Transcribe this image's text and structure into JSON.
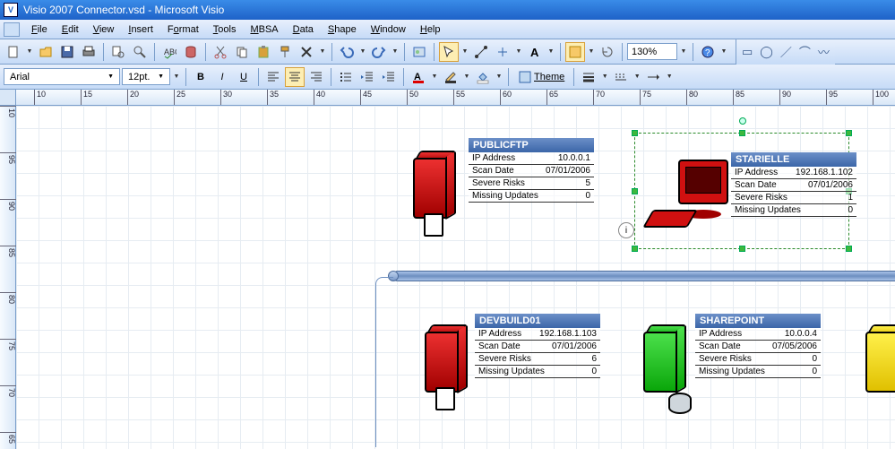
{
  "window": {
    "title": "Visio 2007 Connector.vsd - Microsoft Visio"
  },
  "menu": [
    "File",
    "Edit",
    "View",
    "Insert",
    "Format",
    "Tools",
    "MBSA",
    "Data",
    "Shape",
    "Window",
    "Help"
  ],
  "format": {
    "font": "Arial",
    "size": "12pt.",
    "zoom": "130%",
    "theme": "Theme"
  },
  "ruler_h": [
    "10",
    "15",
    "20",
    "25",
    "30",
    "35",
    "40",
    "45",
    "50",
    "55",
    "60",
    "65",
    "70",
    "75",
    "80",
    "85",
    "90",
    "95",
    "100"
  ],
  "ruler_v": [
    "10",
    "95",
    "90",
    "85",
    "80",
    "75",
    "70",
    "65"
  ],
  "nodes": [
    {
      "name": "PUBLICFTP",
      "rows": [
        [
          "IP Address",
          "10.0.0.1"
        ],
        [
          "Scan Date",
          "07/01/2006"
        ],
        [
          "Severe Risks",
          "5"
        ],
        [
          "Missing Updates",
          "0"
        ]
      ]
    },
    {
      "name": "STARIELLE",
      "rows": [
        [
          "IP Address",
          "192.168.1.102"
        ],
        [
          "Scan Date",
          "07/01/2006"
        ],
        [
          "Severe Risks",
          "1"
        ],
        [
          "Missing Updates",
          "0"
        ]
      ]
    },
    {
      "name": "DEVBUILD01",
      "rows": [
        [
          "IP Address",
          "192.168.1.103"
        ],
        [
          "Scan Date",
          "07/01/2006"
        ],
        [
          "Severe Risks",
          "6"
        ],
        [
          "Missing Updates",
          "0"
        ]
      ]
    },
    {
      "name": "SHAREPOINT",
      "rows": [
        [
          "IP Address",
          "10.0.0.4"
        ],
        [
          "Scan Date",
          "07/05/2006"
        ],
        [
          "Severe Risks",
          "0"
        ],
        [
          "Missing Updates",
          "0"
        ]
      ]
    }
  ]
}
